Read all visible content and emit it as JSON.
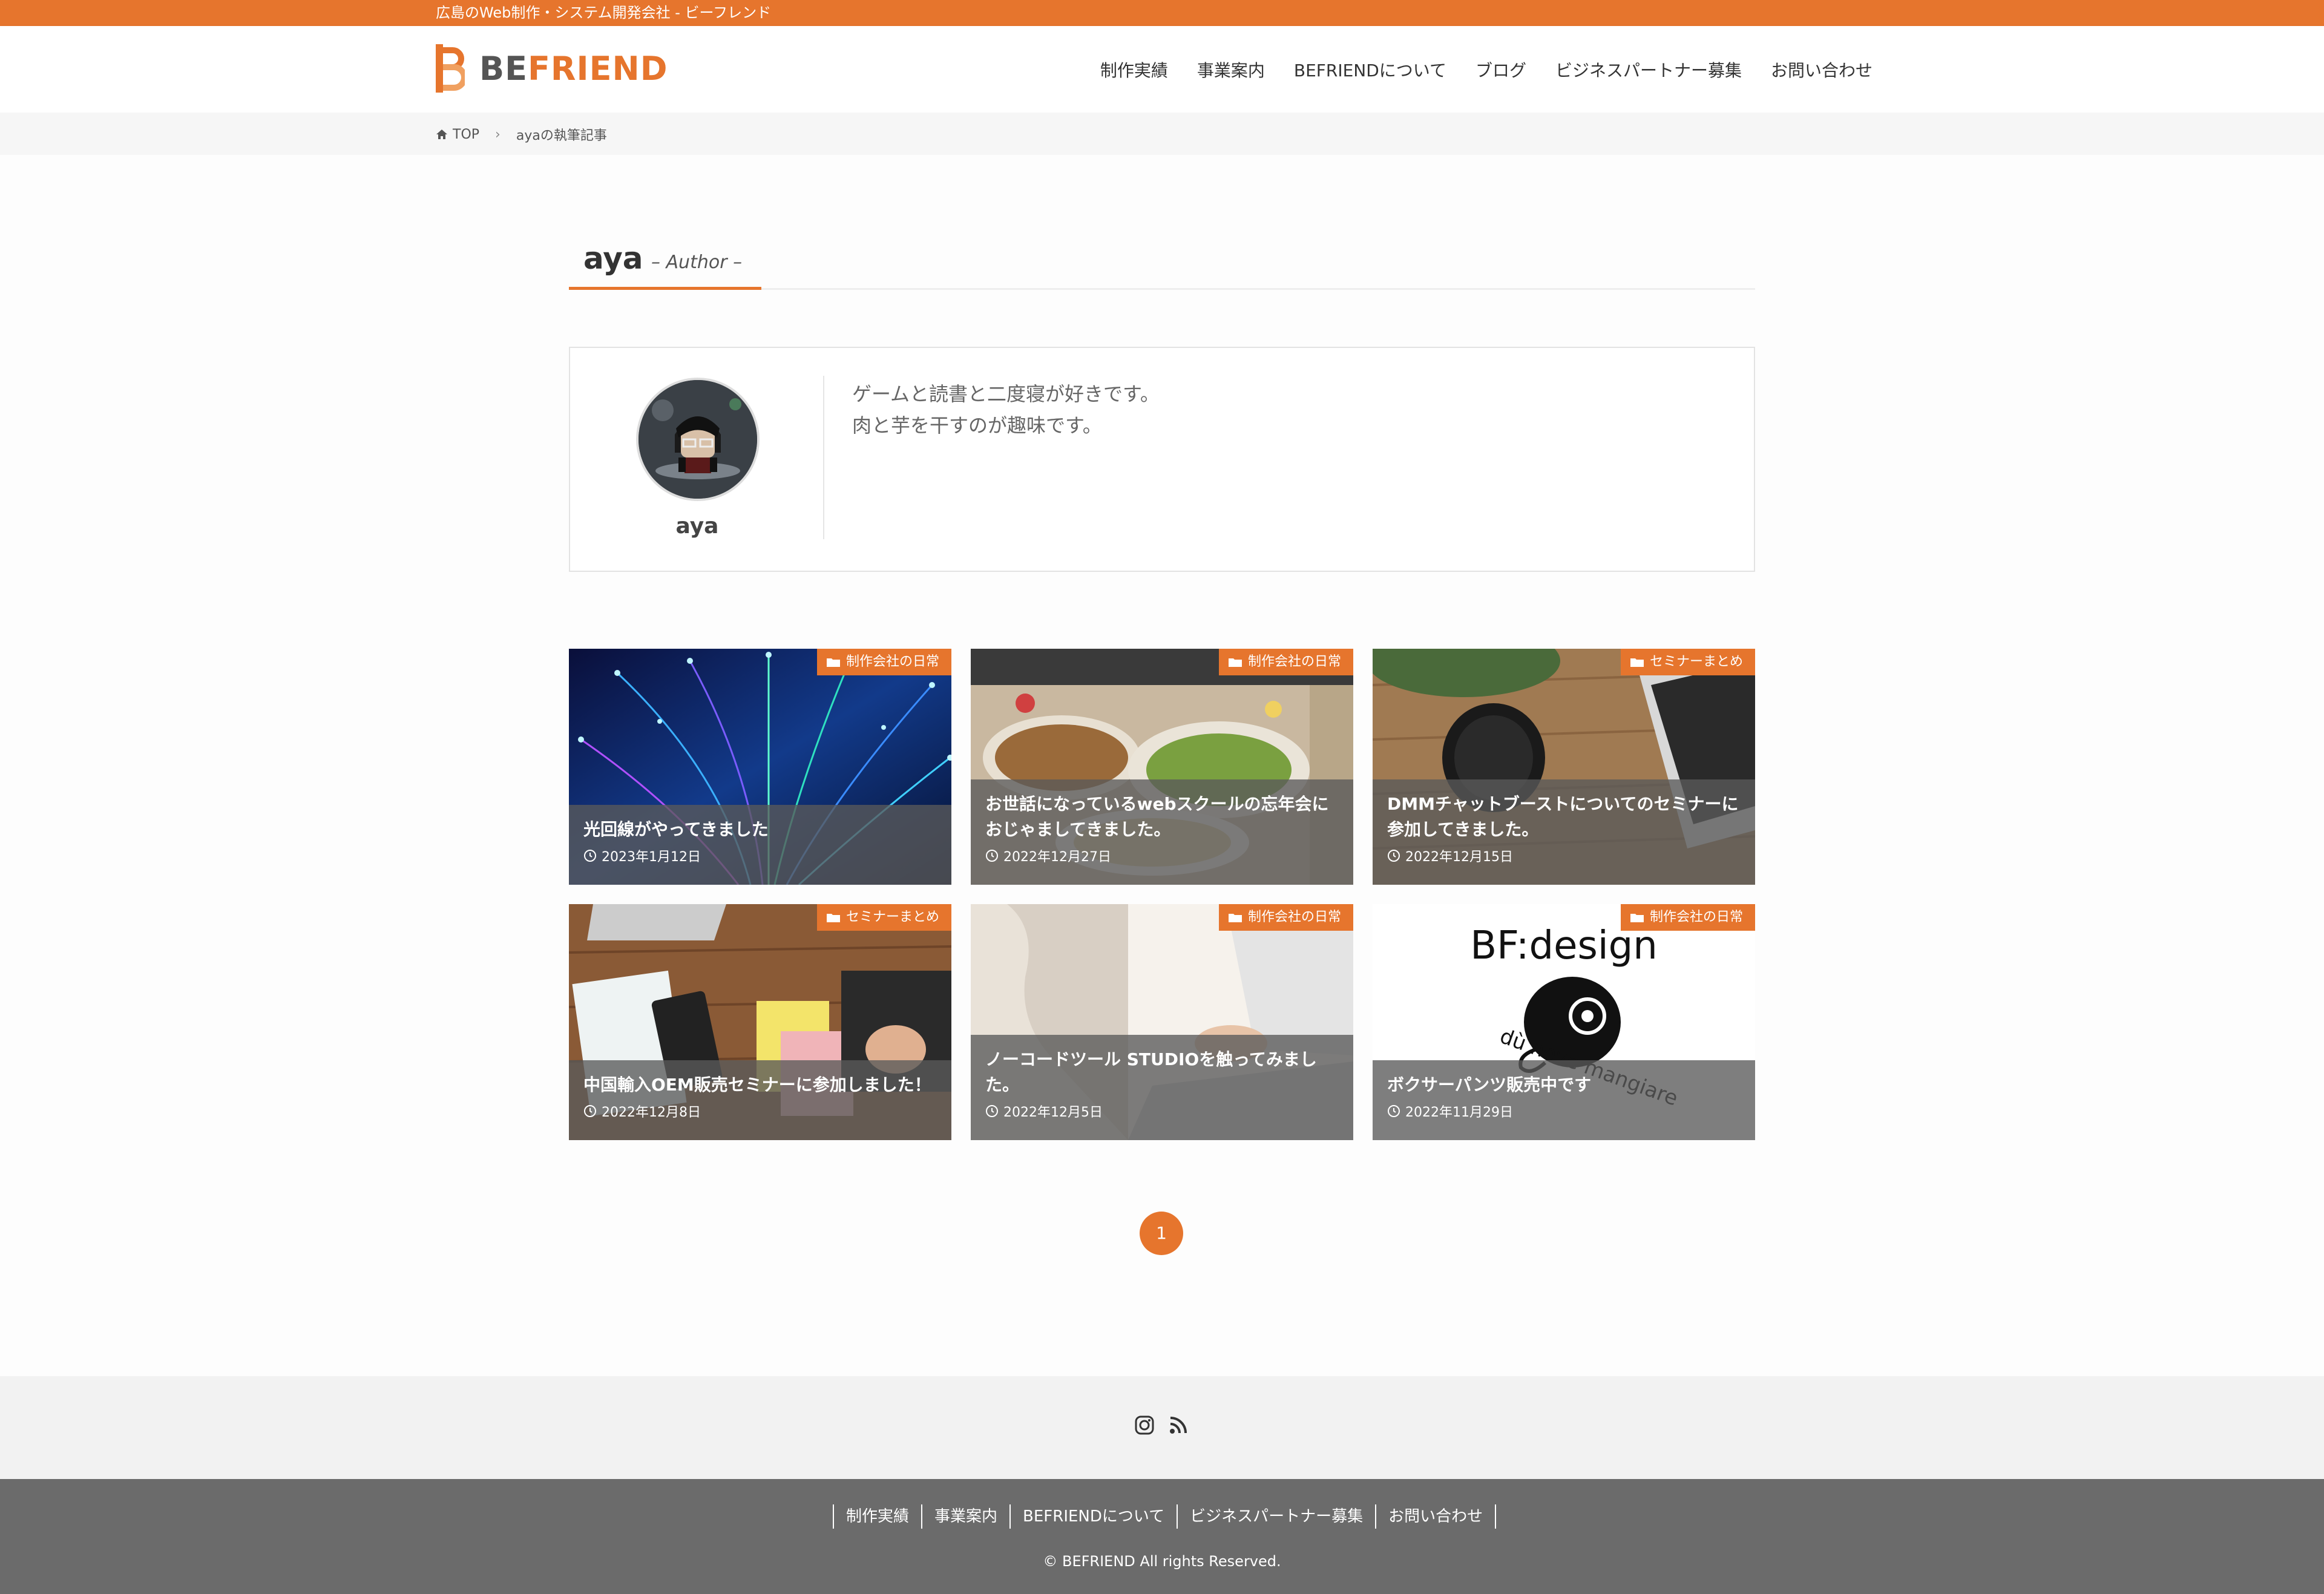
{
  "topbar": {
    "tagline": "広島のWeb制作・システム開発会社 - ビーフレンド"
  },
  "header": {
    "logo_be": "BE",
    "logo_friend": "FRIEND",
    "nav": [
      "制作実績",
      "事業案内",
      "BEFRIENDについて",
      "ブログ",
      "ビジネスパートナー募集",
      "お問い合わせ"
    ]
  },
  "breadcrumb": {
    "home": "TOP",
    "current": "ayaの執筆記事"
  },
  "page": {
    "title": "aya",
    "subtitle": "– Author –"
  },
  "profile": {
    "name": "aya",
    "bio_line1": "ゲームと読書と二度寝が好きです。",
    "bio_line2": "肉と芋を干すのが趣味です。"
  },
  "posts": [
    {
      "category": "制作会社の日常",
      "title": "光回線がやってきました",
      "date": "2023年1月12日"
    },
    {
      "category": "制作会社の日常",
      "title": "お世話になっているwebスクールの忘年会におじゃましてきました。",
      "date": "2022年12月27日"
    },
    {
      "category": "セミナーまとめ",
      "title": "DMMチャットブーストについてのセミナーに参加してきました。",
      "date": "2022年12月15日"
    },
    {
      "category": "セミナーまとめ",
      "title": "中国輸入OEM販売セミナーに参加しました！",
      "date": "2022年12月8日"
    },
    {
      "category": "制作会社の日常",
      "title": "ノーコードツール STUDIOを触ってみました。",
      "date": "2022年12月5日"
    },
    {
      "category": "制作会社の日常",
      "title": "ボクサーパンツ販売中です",
      "date": "2022年11月29日"
    }
  ],
  "post6_image_text": {
    "brand": "BF:design",
    "slogan": "dù nove mangiare"
  },
  "pagination": {
    "current": "1"
  },
  "footer": {
    "nav": [
      "制作実績",
      "事業案内",
      "BEFRIENDについて",
      "ビジネスパートナー募集",
      "お問い合わせ"
    ],
    "copyright": "© BEFRIEND All rights Reserved."
  },
  "colors": {
    "accent": "#e6752d",
    "footer": "#6b6b6b"
  }
}
